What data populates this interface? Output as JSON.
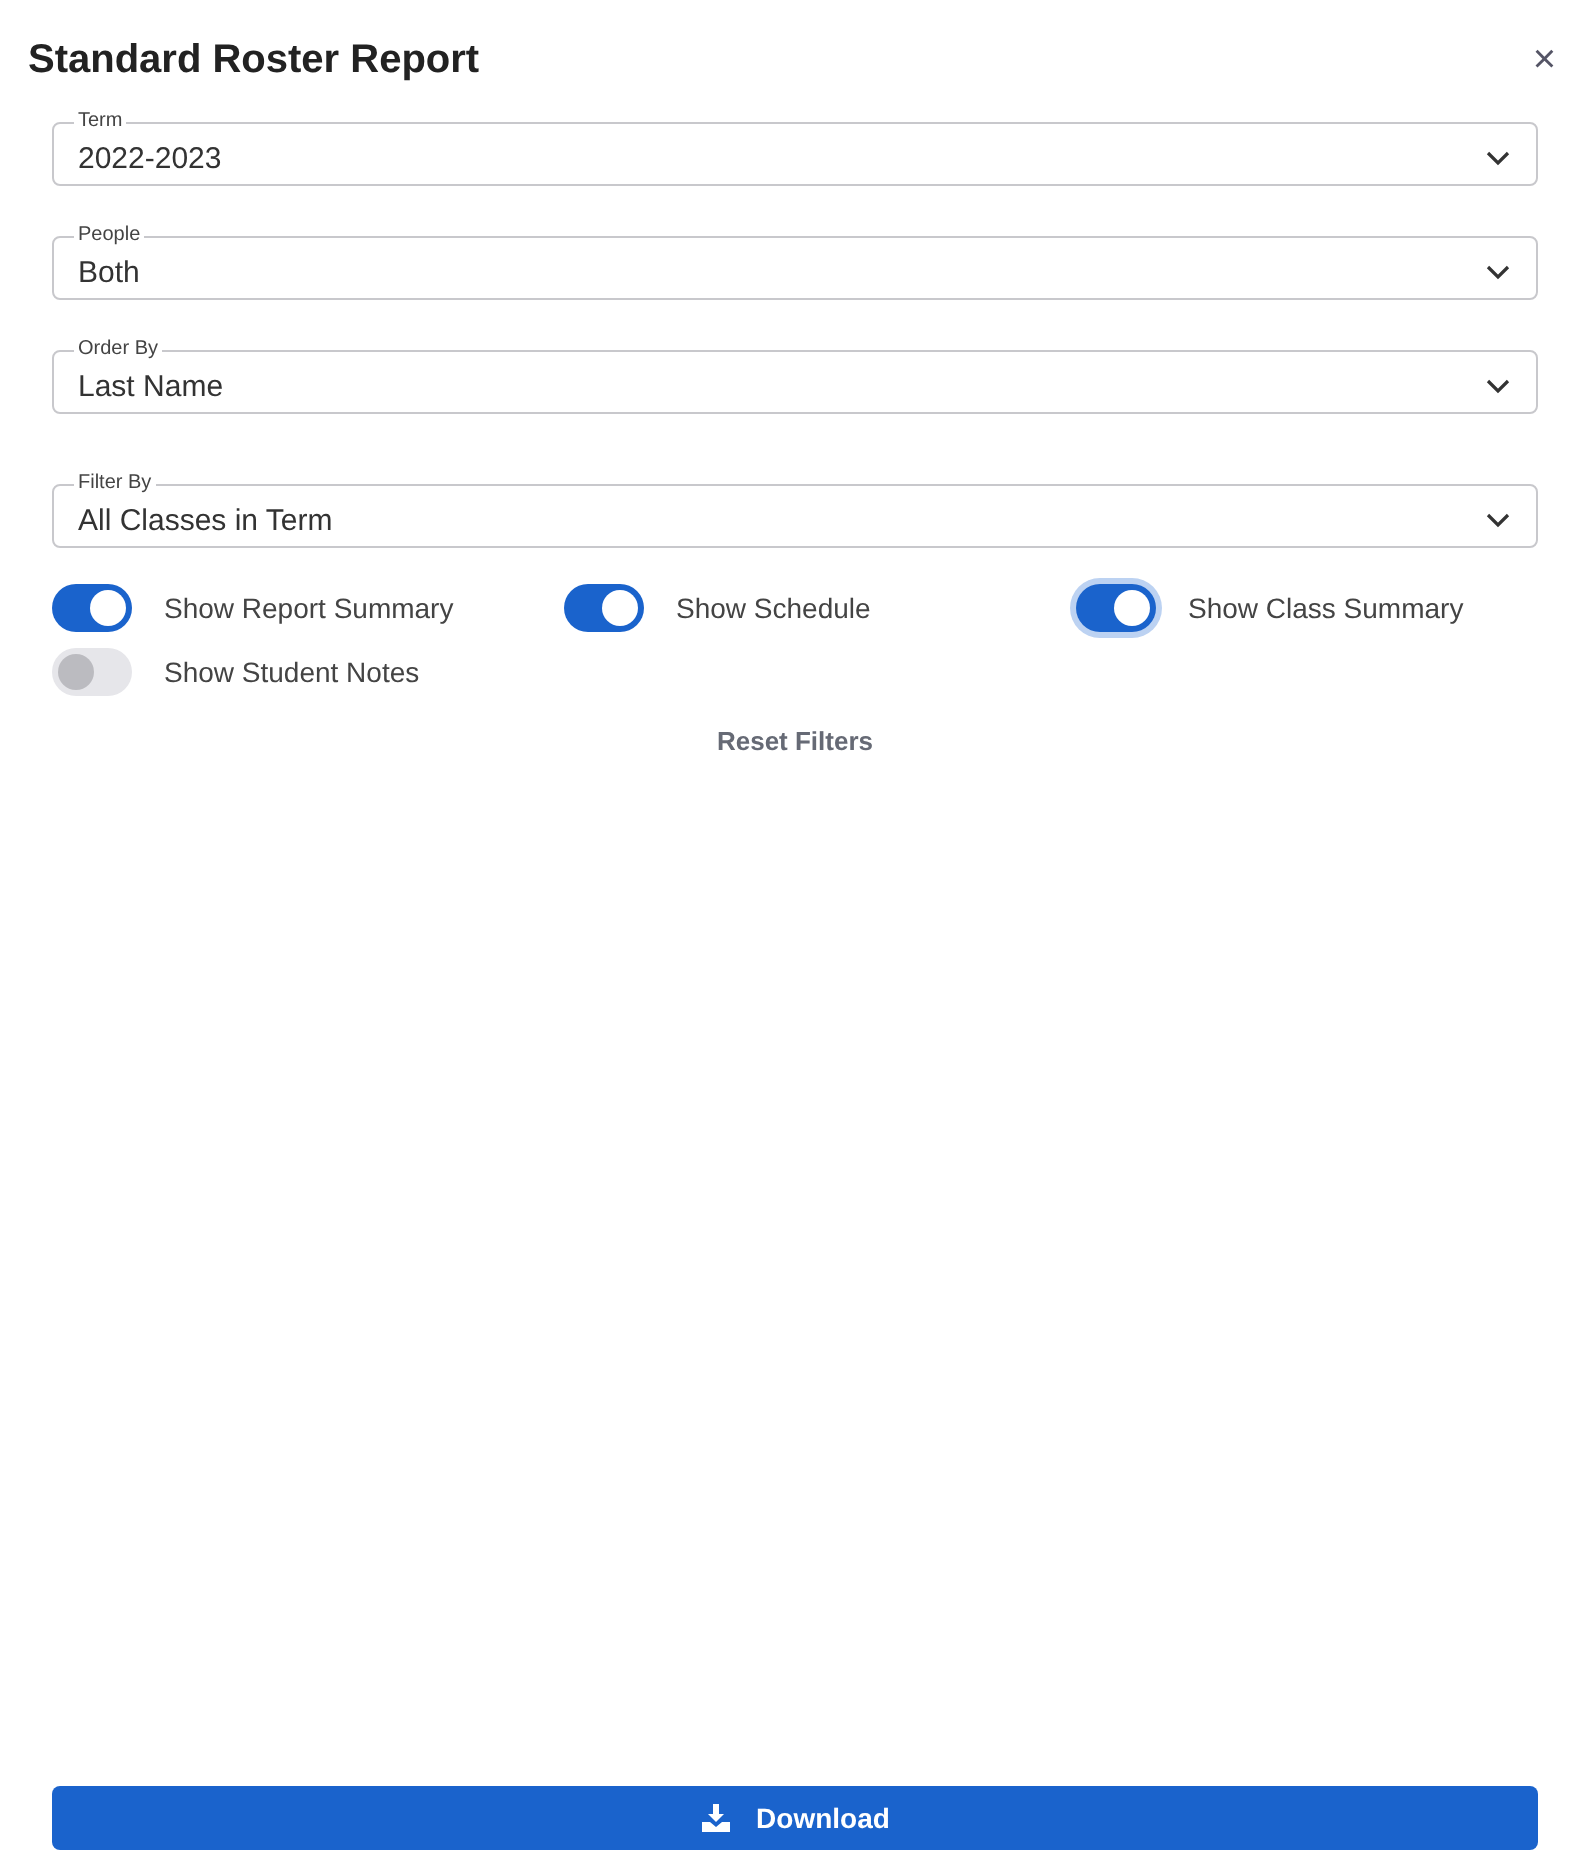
{
  "dialog": {
    "title": "Standard Roster Report",
    "close": "×"
  },
  "fields": [
    {
      "label": "Term",
      "value": "2022-2023"
    },
    {
      "label": "People",
      "value": "Both"
    },
    {
      "label": "Order By",
      "value": "Last Name"
    },
    {
      "label": "Filter By",
      "value": "All Classes in Term"
    }
  ],
  "toggles": [
    {
      "label": "Show Report Summary",
      "on": true,
      "focused": false
    },
    {
      "label": "Show Schedule",
      "on": true,
      "focused": false
    },
    {
      "label": "Show Class Summary",
      "on": true,
      "focused": true
    },
    {
      "label": "Show Student Notes",
      "on": false,
      "focused": false
    }
  ],
  "reset_button": "Reset Filters",
  "download_button": "Download"
}
